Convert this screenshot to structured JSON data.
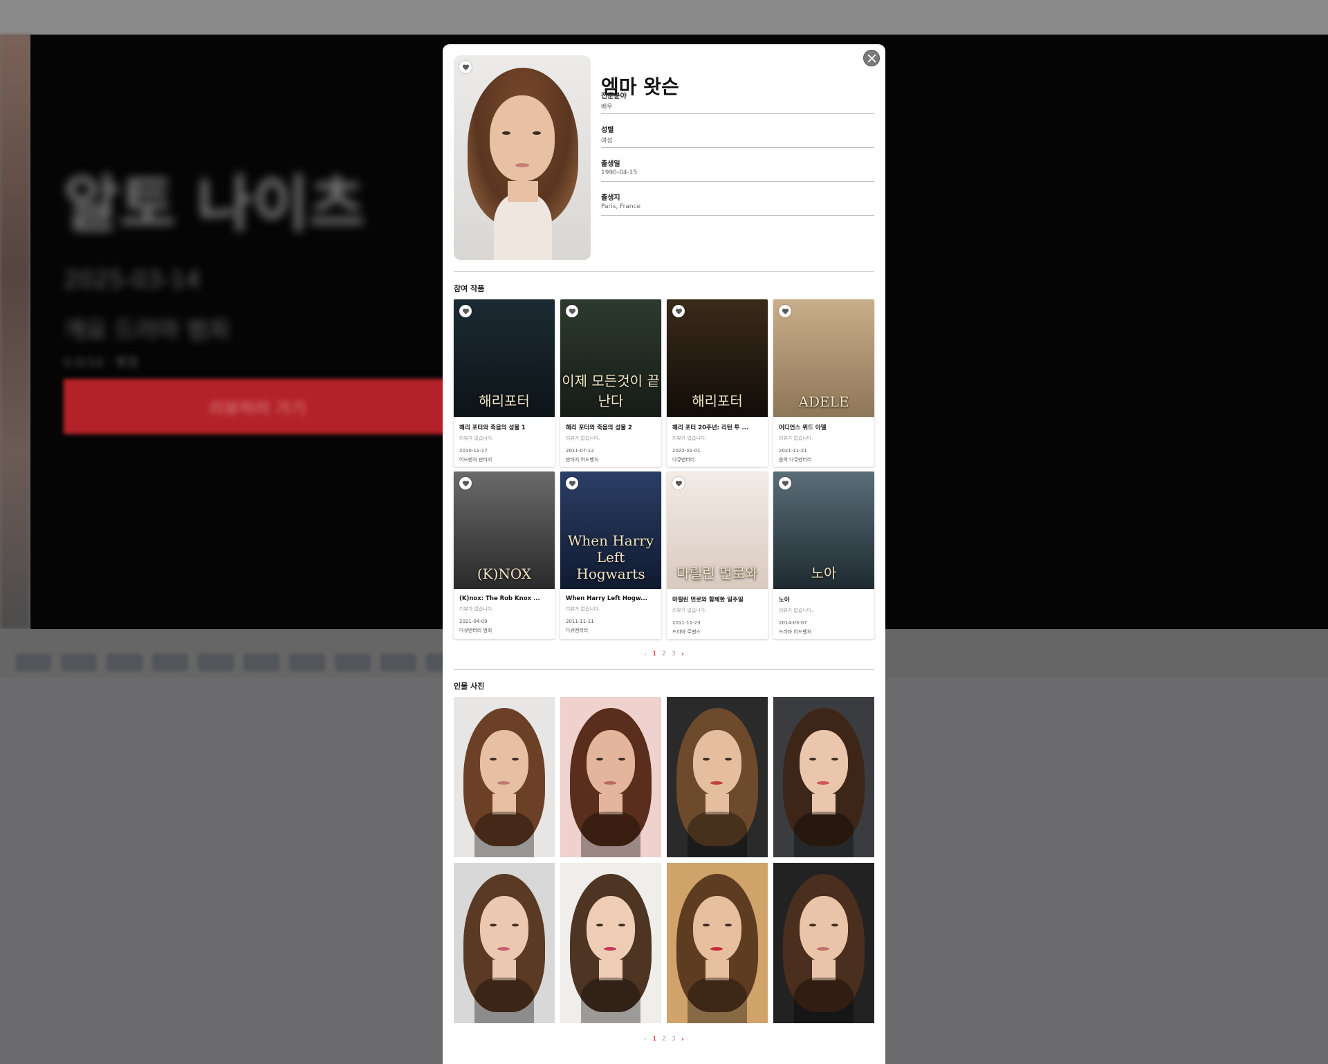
{
  "background": {
    "title": "알토 나이츠",
    "line1": "2025-03-14",
    "line2": "개요 드라마 범죄",
    "line3": "0.0/10 · 평점",
    "cta": "리뷰하러 가기"
  },
  "profile": {
    "name": "엠마 왓슨",
    "fields": [
      {
        "label": "전문분야",
        "value": "배우"
      },
      {
        "label": "성별",
        "value": "여성"
      },
      {
        "label": "출생일",
        "value": "1990-04-15"
      },
      {
        "label": "출생지",
        "value": "Paris, France"
      }
    ]
  },
  "works": {
    "title": "참여 작품",
    "items": [
      {
        "title": "해리 포터와 죽음의 성물 1",
        "review": "리뷰가 없습니다.",
        "date": "2010-11-17",
        "genre": "어드벤처 판타지",
        "poster_text": "해리포터",
        "colors": [
          "#1c2a33",
          "#0d1418"
        ]
      },
      {
        "title": "해리 포터와 죽음의 성물 2",
        "review": "리뷰가 없습니다.",
        "date": "2011-07-12",
        "genre": "판타지 어드벤처",
        "poster_text": "이제 모든것이 끝난다",
        "colors": [
          "#2d3a2e",
          "#161c17"
        ]
      },
      {
        "title": "해리 포터 20주년: 리턴 투 ...",
        "review": "리뷰가 없습니다.",
        "date": "2022-01-01",
        "genre": "다큐멘터리",
        "poster_text": "해리포터",
        "colors": [
          "#3a2a1a",
          "#120d08"
        ]
      },
      {
        "title": "어디언스 위드 아델",
        "review": "리뷰가 없습니다.",
        "date": "2021-11-21",
        "genre": "음악 다큐멘터리",
        "poster_text": "ADELE",
        "colors": [
          "#c9ae8a",
          "#8e7658"
        ]
      },
      {
        "title": "(K)nox: The Rob Knox ...",
        "review": "리뷰가 없습니다.",
        "date": "2021-04-09",
        "genre": "다큐멘터리 범죄",
        "poster_text": "(K)NOX",
        "colors": [
          "#6a6a6a",
          "#2a2a2a"
        ]
      },
      {
        "title": "When Harry Left Hogw...",
        "review": "리뷰가 없습니다.",
        "date": "2011-11-11",
        "genre": "다큐멘터리",
        "poster_text": "When Harry Left Hogwarts",
        "colors": [
          "#2b3e66",
          "#101a30"
        ]
      },
      {
        "title": "마릴린 먼로와 함께한 일주일",
        "review": "리뷰가 없습니다.",
        "date": "2011-11-23",
        "genre": "드라마 로맨스",
        "poster_text": "마릴린 먼로와",
        "colors": [
          "#f3ece6",
          "#d9c9bf"
        ]
      },
      {
        "title": "노아",
        "review": "리뷰가 없습니다.",
        "date": "2014-03-07",
        "genre": "드라마 어드벤처",
        "poster_text": "노아",
        "colors": [
          "#5a6e78",
          "#1e2a30"
        ]
      }
    ],
    "pagination": {
      "pages": [
        "1",
        "2",
        "3"
      ],
      "active": "1",
      "prev": "‹",
      "next": "›"
    }
  },
  "photos": {
    "title": "인물 사진",
    "items": [
      {
        "bg": "#e8e6e4",
        "hair": "#6b4026",
        "skin": "#e7c0a4",
        "lip": "#c07a72"
      },
      {
        "bg": "#efd1cd",
        "hair": "#5a2e1c",
        "skin": "#e2b59c",
        "lip": "#b86a60"
      },
      {
        "bg": "#2a2a2a",
        "hair": "#6d4a2c",
        "skin": "#e5bea0",
        "lip": "#c2443e"
      },
      {
        "bg": "#3a3c40",
        "hair": "#3d2518",
        "skin": "#eac6ad",
        "lip": "#d0565e"
      },
      {
        "bg": "#d8d8d8",
        "hair": "#5a3a24",
        "skin": "#ecc8b0",
        "lip": "#c85d6c"
      },
      {
        "bg": "#f0eeea",
        "hair": "#4e3422",
        "skin": "#efcdb4",
        "lip": "#c23a5a"
      },
      {
        "bg": "#cfa36a",
        "hair": "#5e3c22",
        "skin": "#e6bf9e",
        "lip": "#c82a3a"
      },
      {
        "bg": "#222222",
        "hair": "#4a2e1e",
        "skin": "#eac4a8",
        "lip": "#c07070"
      }
    ],
    "pagination": {
      "pages": [
        "1",
        "2",
        "3"
      ],
      "active": "1",
      "prev": "‹",
      "next": "›"
    }
  },
  "icons": {
    "close": "close-icon",
    "heart": "heart-icon"
  },
  "colors": {
    "accent": "#e50914"
  }
}
